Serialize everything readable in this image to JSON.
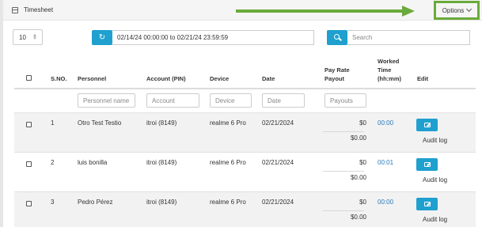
{
  "panel": {
    "title": "Timesheet",
    "title_icon": "calendar-icon"
  },
  "options": {
    "label": "Options",
    "icon": "chevron-down-icon"
  },
  "annotation": {
    "color": "#6aaa3a",
    "shape": "arrow"
  },
  "toolbar": {
    "page_size": "10",
    "reset_icon": "refresh-icon",
    "date_range": "02/14/24 00:00:00 to 02/21/24 23:59:59",
    "search_icon": "search-icon",
    "search_placeholder": "Search"
  },
  "colors": {
    "accent": "#1fa0cf",
    "link": "#2a7ab8",
    "highlight": "#6aaa3a"
  },
  "columns": {
    "sno": "S.NO.",
    "personnel": "Personnel",
    "account": "Account (PIN)",
    "device": "Device",
    "date": "Date",
    "pay_line1": "Pay Rate",
    "pay_line2": "Payout",
    "worked_line1": "Worked",
    "worked_line2": "Time",
    "worked_line3": "(hh:mm)",
    "edit": "Edit"
  },
  "filters": {
    "personnel": "Personnel name",
    "account": "Account",
    "device": "Device",
    "date": "Date",
    "payouts": "Payouts"
  },
  "rows": [
    {
      "sno": "1",
      "personnel": "Otro Test Testio",
      "account": "itroi (8149)",
      "device": "realme 6 Pro",
      "date": "02/21/2024",
      "pay_rate": "$0",
      "payout": "$0.00",
      "worked": "00:00",
      "audit": "Audit log"
    },
    {
      "sno": "2",
      "personnel": "luis bonilla",
      "account": "itroi (8149)",
      "device": "realme 6 Pro",
      "date": "02/21/2024",
      "pay_rate": "$0",
      "payout": "$0.00",
      "worked": "00:01",
      "audit": "Audit log"
    },
    {
      "sno": "3",
      "personnel": "Pedro Pérez",
      "account": "itroi (8149)",
      "device": "realme 6 Pro",
      "date": "02/21/2024",
      "pay_rate": "$0",
      "payout": "$0.00",
      "worked": "00:00",
      "audit": "Audit log"
    }
  ]
}
